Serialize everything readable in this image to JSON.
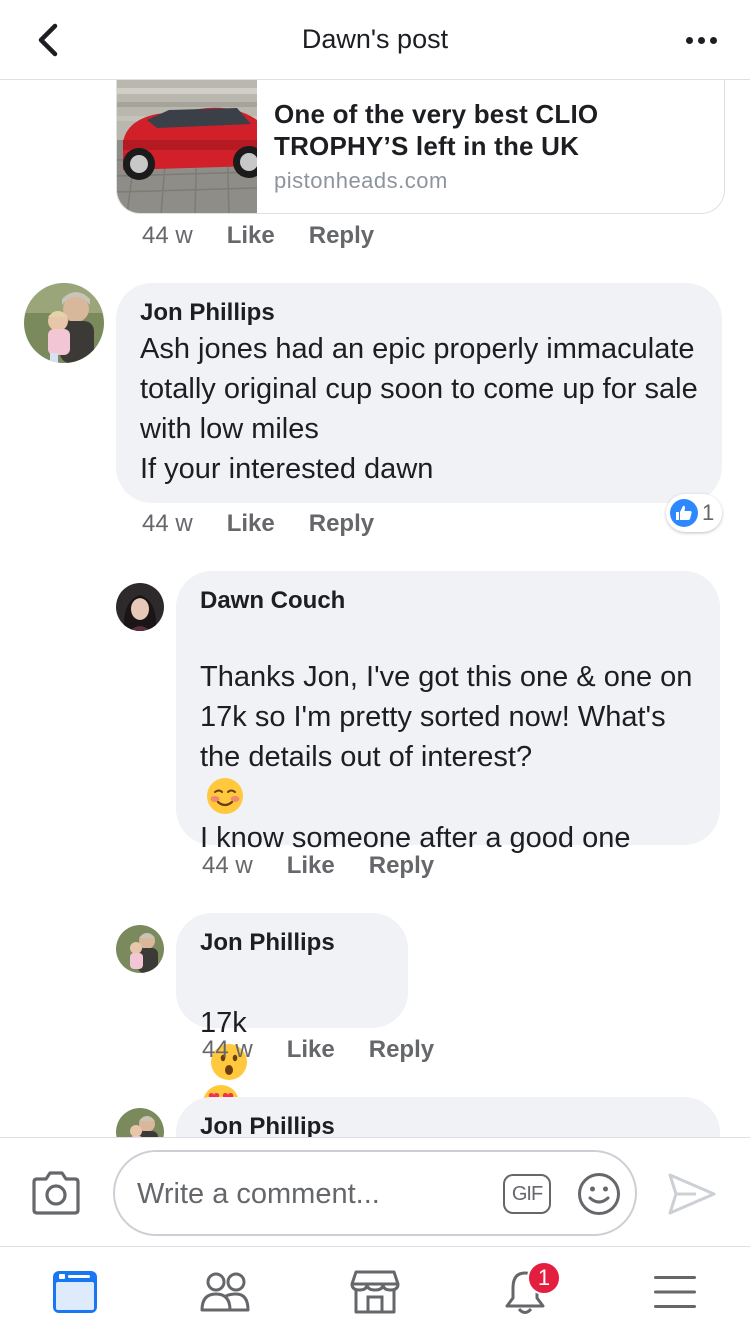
{
  "header": {
    "title": "Dawn's post"
  },
  "link_preview": {
    "title": "One of the very best CLIO TROPHY’S left in the UK",
    "domain": "pistonheads.com",
    "time": "44 w",
    "like_label": "Like",
    "reply_label": "Reply"
  },
  "comments": [
    {
      "author": "Jon Phillips",
      "text": "Ash jones had an epic properly immaculate totally original cup soon to come up for sale with low miles\nIf your interested dawn",
      "time": "44 w",
      "like_label": "Like",
      "reply_label": "Reply",
      "reaction_count": "1"
    },
    {
      "author": "Dawn Couch",
      "text_before_emoji": "Thanks Jon, I've got this one & one on 17k so I'm pretty sorted now! What's the details out of interest?",
      "text_after_emoji": "I know someone after a good one",
      "time": "44 w",
      "like_label": "Like",
      "reply_label": "Reply"
    },
    {
      "author": "Jon Phillips",
      "text": "17k",
      "time": "44 w",
      "like_label": "Like",
      "reply_label": "Reply"
    },
    {
      "author": "Jon Phillips"
    }
  ],
  "composer": {
    "placeholder": "Write a comment...",
    "gif_label": "GIF"
  },
  "bottom_nav": {
    "notifications_badge": "1"
  },
  "colors": {
    "accent": "#1877f2",
    "like_blue": "#2d88ff",
    "badge_red": "#e41e3f",
    "bubble_bg": "#f0f2f5",
    "meta_gray": "#65676b"
  }
}
